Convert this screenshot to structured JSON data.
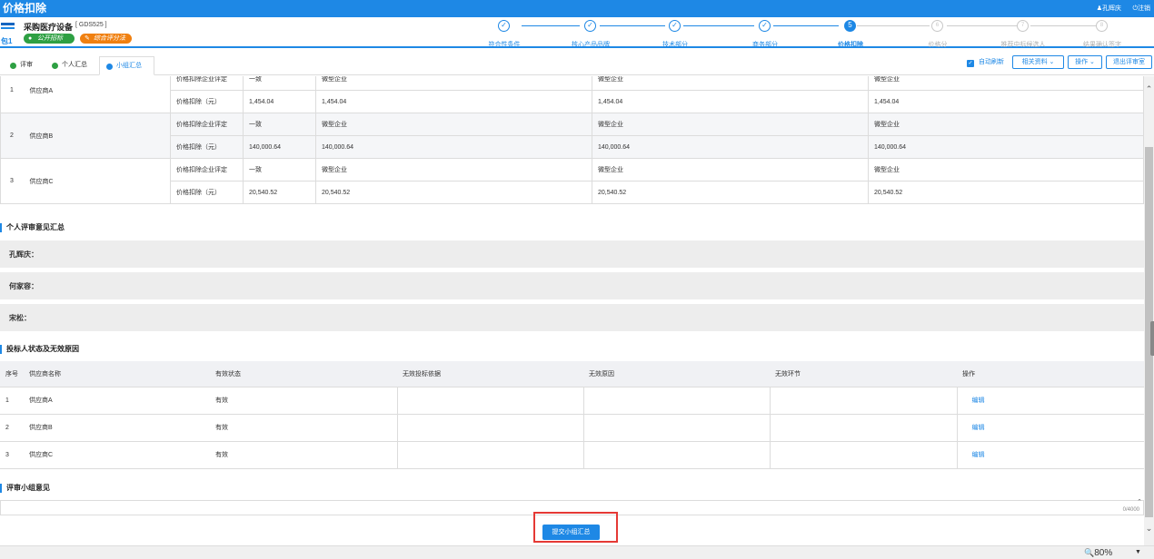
{
  "app": {
    "title": "价格扣除",
    "user": "孔辉庆",
    "logout": "注销"
  },
  "project": {
    "name": "采购医疗设备",
    "code": "[ GDS525 ]",
    "package": "包1",
    "badges": [
      "公开招标",
      "综合评分法"
    ]
  },
  "steps": [
    {
      "label": "符合性条件",
      "mark": "✓",
      "state": "done"
    },
    {
      "label": "核心产品品牌",
      "mark": "✓",
      "state": "done"
    },
    {
      "label": "技术部分",
      "mark": "✓",
      "state": "done"
    },
    {
      "label": "商务部分",
      "mark": "✓",
      "state": "done"
    },
    {
      "label": "价格扣除",
      "mark": "5",
      "state": "current"
    },
    {
      "label": "价格分",
      "mark": "6",
      "state": "pending"
    },
    {
      "label": "推荐中标候选人",
      "mark": "7",
      "state": "pending"
    },
    {
      "label": "结果确认签字",
      "mark": "8",
      "state": "pending"
    }
  ],
  "tabs": [
    "评审",
    "个人汇总",
    "小组汇总"
  ],
  "toolbar": {
    "auto_refresh": "自动刷新",
    "related": "相关资料",
    "operate": "操作",
    "exit": "退出评审室"
  },
  "price_rows": [
    {
      "seq": "1",
      "name": "供应商A",
      "item1": "价格扣除企业评定",
      "v1": [
        "一致",
        "微型企业",
        "微型企业",
        "微型企业"
      ],
      "item2": "价格扣除（元）",
      "v2": [
        "1,454.04",
        "1,454.04",
        "1,454.04",
        "1,454.04"
      ]
    },
    {
      "seq": "2",
      "name": "供应商B",
      "item1": "价格扣除企业评定",
      "v1": [
        "一致",
        "微型企业",
        "微型企业",
        "微型企业"
      ],
      "item2": "价格扣除（元）",
      "v2": [
        "140,000.64",
        "140,000.64",
        "140,000.64",
        "140,000.64"
      ]
    },
    {
      "seq": "3",
      "name": "供应商C",
      "item1": "价格扣除企业评定",
      "v1": [
        "一致",
        "微型企业",
        "微型企业",
        "微型企业"
      ],
      "item2": "价格扣除（元）",
      "v2": [
        "20,540.52",
        "20,540.52",
        "20,540.52",
        "20,540.52"
      ]
    }
  ],
  "opinion_section": {
    "title": "个人评审意见汇总",
    "reviewers": [
      "孔辉庆：",
      "何家容：",
      "宋松："
    ]
  },
  "status_section": {
    "title": "投标人状态及无效原因",
    "headers": [
      "序号",
      "供应商名称",
      "有效状态",
      "无效投标依据",
      "无效原因",
      "无效环节",
      "操作"
    ],
    "rows": [
      {
        "seq": "1",
        "name": "供应商A",
        "status": "有效",
        "basis": "",
        "reason": "",
        "stage": "",
        "action": "编辑"
      },
      {
        "seq": "2",
        "name": "供应商B",
        "status": "有效",
        "basis": "",
        "reason": "",
        "stage": "",
        "action": "编辑"
      },
      {
        "seq": "3",
        "name": "供应商C",
        "status": "有效",
        "basis": "",
        "reason": "",
        "stage": "",
        "action": "编辑"
      }
    ]
  },
  "group_opinion": {
    "title": "评审小组意见",
    "value": "",
    "counter": "0/4000"
  },
  "submit_label": "提交小组汇总",
  "zoom": "80%",
  "colors": {
    "accent": "#1e88e5",
    "green": "#2ea043",
    "orange": "#f08010",
    "highlight": "#e53935"
  }
}
